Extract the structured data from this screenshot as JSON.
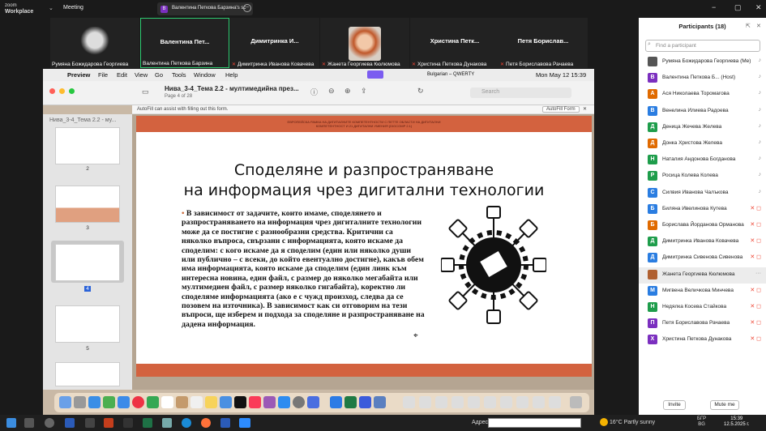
{
  "zoom": {
    "app_name": "zoom",
    "app_sub": "Workplace",
    "meeting_label": "Meeting",
    "share_label": "Валентина Петкова Барзина's sc"
  },
  "tiles": [
    {
      "name": "",
      "caption": "Румяна Божидарова Георгиева",
      "muted": false,
      "photo": "dark"
    },
    {
      "name": "Валентина Пет...",
      "caption": "Валентина Петкова Барзина",
      "muted": false,
      "active": true
    },
    {
      "name": "Димитринка И...",
      "caption": "Димитринка Иванова Ковачева",
      "muted": true
    },
    {
      "name": "",
      "caption": "Жанета Георгиева Кюлюмова",
      "muted": true,
      "photo": "orange"
    },
    {
      "name": "Христина Петк...",
      "caption": "Христина Петкова Дунакова",
      "muted": true
    },
    {
      "name": "Петя Борислав...",
      "caption": "Петя Бориславова Рачаева",
      "muted": true
    }
  ],
  "mac": {
    "menu": [
      "Preview",
      "File",
      "Edit",
      "View",
      "Go",
      "Tools",
      "Window",
      "Help"
    ],
    "status_right": "Mon May 12 15:39",
    "keyboard": "Bulgarian – QWERTY",
    "doc_title": "Нива_3-4_Тема 2.2 - мултимедийна през...",
    "doc_page": "Page 4 of 28",
    "search_placeholder": "Search",
    "autofill_text": "AutoFill can assist with filling out this form.",
    "autofill_button": "AutoFill Form",
    "sidebar_header": "Нива_3-4_Тема 2.2 - му...",
    "thumbs": [
      "2",
      "3",
      "4",
      "5"
    ]
  },
  "slide": {
    "header_line1": "ЕВРОПЕЙСКА РАМКА НА ДИГИТАЛНИТЕ КОМПЕТЕНТНОСТИ С ПЕТТЕ ОБЛАСТИ НА ДИГИТАЛНИ",
    "header_line2": "КОМПЕТЕНТНОСТ И 21 ДИГИТАЛНИ УМЕНИЯ (DIGCOMP 2.1)",
    "title_line1": "Споделяне и разпространяване",
    "title_line2": "на информация чрез дигитални технологии",
    "body": "В зависимост от задачите, които имаме, споделянето и разпространяването на информация чрез дигиталните технологии може да се постигне с разнообразни средства. Критични са няколко въпроса, свързани с информацията, която искаме да споделим: с кого искаме да я споделим (един или няколко души или публично – с всеки, до който евентуално достигне), какъв обем има информацията, която искаме да споделим (един линк към интересна новина, един файл, с размер до няколко мегабайта или мултимедиен файл, с размер няколко гигабайта), коректно ли споделяме информацията (ако е с чужд произход, следва да се позовем на източника). В зависимост как си отговорим на тези въпроси, ще изберем и подхода за споделяне и разпространяване на дадена информация."
  },
  "participants": {
    "title": "Participants (18)",
    "search_placeholder": "Find a participant",
    "list": [
      {
        "name": "Румяна Божидарова Георгиева (Me)",
        "initial": "",
        "color": "#555",
        "mic": "on"
      },
      {
        "name": "Валентина Петкова Б... (Host)",
        "initial": "В",
        "color": "#7b2fbf",
        "mic": "on"
      },
      {
        "name": "Ася Николаева Торомагова",
        "initial": "А",
        "color": "#e06a00",
        "mic": "on"
      },
      {
        "name": "Венелина Илиева Радоева",
        "initial": "В",
        "color": "#2a7de1",
        "mic": "on"
      },
      {
        "name": "Деница Жечева Желева",
        "initial": "Д",
        "color": "#1e9d4b",
        "mic": "on"
      },
      {
        "name": "Донка Христова Желева",
        "initial": "Д",
        "color": "#e06a00",
        "mic": "on"
      },
      {
        "name": "Наталия Андонова Богданова",
        "initial": "Н",
        "color": "#1e9d4b",
        "mic": "on"
      },
      {
        "name": "Росица Колева Колева",
        "initial": "Р",
        "color": "#1e9d4b",
        "mic": "on"
      },
      {
        "name": "Силвия Иванова Чалъкова",
        "initial": "С",
        "color": "#2a7de1",
        "mic": "on"
      },
      {
        "name": "Биляна Ивелинова Кутева",
        "initial": "Б",
        "color": "#2a7de1",
        "mic": "off"
      },
      {
        "name": "Борислава Йорданова Орманова",
        "initial": "Б",
        "color": "#e06a00",
        "mic": "off"
      },
      {
        "name": "Димитринка Иванова Ковачева",
        "initial": "Д",
        "color": "#1e9d4b",
        "mic": "off"
      },
      {
        "name": "Димитринка Сивенова Сивенова",
        "initial": "Д",
        "color": "#2a7de1",
        "mic": "off"
      },
      {
        "name": "Жанета Георгиева Кюлюмова",
        "initial": "",
        "color": "#b06030",
        "mic": "more",
        "highlight": true
      },
      {
        "name": "Мигвена Величкова Минчева",
        "initial": "М",
        "color": "#2a7de1",
        "mic": "off"
      },
      {
        "name": "Недялка Косева Стайкова",
        "initial": "Н",
        "color": "#1e9d4b",
        "mic": "off"
      },
      {
        "name": "Петя Бориславова Рачаева",
        "initial": "П",
        "color": "#7b2fbf",
        "mic": "off"
      },
      {
        "name": "Христина Петкова Дунакова",
        "initial": "Х",
        "color": "#7b2fbf",
        "mic": "off"
      }
    ],
    "invite_label": "Invite",
    "mute_all_label": "Mute me"
  },
  "taskbar": {
    "address_label": "Адрес",
    "weather": "16°C  Partly sunny",
    "lang": "БГР",
    "lang2": "BG",
    "time": "15:39",
    "date": "12.5.2025 г."
  }
}
